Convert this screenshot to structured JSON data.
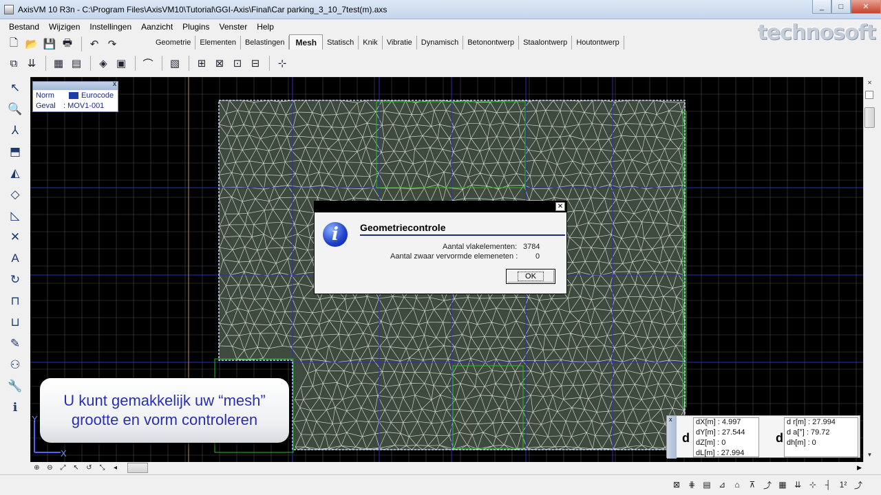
{
  "window": {
    "title": "AxisVM 10 R3n - C:\\Program Files\\AxisVM10\\Tutorial\\GGI-Axis\\Final\\Car parking_3_10_7test(m).axs",
    "min_glyph": "_",
    "max_glyph": "□",
    "close_glyph": "✕"
  },
  "menu": [
    "Bestand",
    "Wijzigen",
    "Instellingen",
    "Aanzicht",
    "Plugins",
    "Venster",
    "Help"
  ],
  "logo": "technosoft",
  "tabs": [
    "Geometrie",
    "Elementen",
    "Belastingen",
    "Mesh",
    "Statisch",
    "Knik",
    "Vibratie",
    "Dynamisch",
    "Betonontwerp",
    "Staalontwerp",
    "Houtontwerp"
  ],
  "active_tab": "Mesh",
  "toolbar_icons_row1": [
    "new-file-icon",
    "open-folder-icon",
    "save-icon",
    "print-icon",
    "undo-icon",
    "redo-icon"
  ],
  "toolbar_glyphs_row1": [
    "🗋",
    "📂",
    "💾",
    "🖶",
    "↶",
    "↷"
  ],
  "toolbar_icons_row2": [
    "layers-icon",
    "elevation-icon",
    "table-icon",
    "report-icon",
    "library-icon",
    "window-icon",
    "arc-icon",
    "mesh-domain-icon",
    "mesh-line-icon",
    "mesh-refine-icon",
    "mesh-node-icon",
    "mesh-grid-icon",
    "mesh-check-icon"
  ],
  "toolbar_glyphs_row2": [
    "⧉",
    "⇊",
    "▦",
    "▤",
    "◈",
    "▣",
    "⌒",
    "▧",
    "⊞",
    "⊠",
    "⊡",
    "⊟",
    "⊹"
  ],
  "left_tools": [
    "select-icon",
    "zoom-icon",
    "axes-icon",
    "move-icon",
    "scale-icon",
    "node-icon",
    "dimension-icon",
    "intersect-icon",
    "text-icon",
    "rotate-icon",
    "support-icon",
    "beam-icon",
    "brush-icon",
    "view-icon",
    "wrench-icon",
    "info-icon"
  ],
  "left_glyphs": [
    "↖",
    "🔍",
    "⅄",
    "⬒",
    "◭",
    "◇",
    "◺",
    "✕",
    "A",
    "↻",
    "⊓",
    "⊔",
    "✎",
    "⚇",
    "🔧",
    "ℹ"
  ],
  "norm_box": {
    "close_glyph": "x",
    "norm_label": "Norm",
    "norm_value": "Eurocode",
    "case_label": "Geval",
    "case_value": ": MOV1-001"
  },
  "dialog": {
    "title": "Geometriecontrole",
    "close_glyph": "✕",
    "icon_glyph": "i",
    "row1_label": "Aantal vlakelementen:",
    "row1_value": "3784",
    "row2_label": "Aantal zwaar vervormde elemeneten :",
    "row2_value": "0",
    "ok_label": "OK"
  },
  "caption": {
    "line1": "U kunt gemakkelijk uw “mesh”",
    "line2": "grootte en vorm controleren"
  },
  "axis_labels": {
    "y": "Y",
    "x": "X"
  },
  "coords": {
    "close_glyph": "x",
    "d_label": "d",
    "dX": "dX[m] :  4.997",
    "dY": "dY[m] :  27.544",
    "dZ": "dZ[m] :  0",
    "dL": "dL[m] :  27.994",
    "r": "d r[m] :  27.994",
    "a": "d  a[°] :  79.72",
    "h": "dh[m] :  0"
  },
  "zoom_glyphs": [
    "⊕",
    "⊖",
    "⤢",
    "↖",
    "↺",
    "⤡",
    "◂"
  ],
  "status_glyphs": [
    "⊠",
    "⋕",
    "▤",
    "⊿",
    "⌂",
    "⊼",
    "⤴"
  ],
  "status_glyphs2": [
    "▦",
    "⇊",
    "⊹",
    "┤",
    "1²",
    "⤴"
  ],
  "colors": {
    "mesh_fill": "#3f4a3e",
    "mesh_line": "#e6ece6",
    "grid": "#4b4b4b",
    "blue_grid": "#2c2fb8",
    "green_outline": "#1fbf1f",
    "caption_text": "#2a2fb0"
  }
}
